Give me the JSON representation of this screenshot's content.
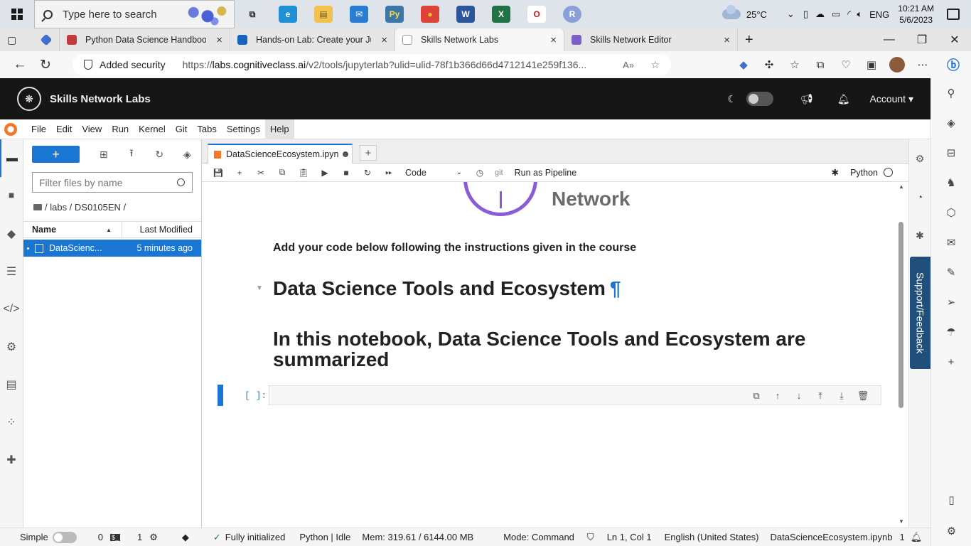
{
  "taskbar": {
    "search_placeholder": "Type here to search",
    "apps": [
      {
        "name": "task-view",
        "glyph": "⧉",
        "color": "transparent",
        "fg": "#222"
      },
      {
        "name": "edge",
        "glyph": "e",
        "color": "#1f8fd6",
        "fg": "#fff"
      },
      {
        "name": "file-explorer",
        "glyph": "▤",
        "color": "#f2c14e",
        "fg": "#6b5a1a"
      },
      {
        "name": "mail",
        "glyph": "✉",
        "color": "#2b7cd3",
        "fg": "#fff"
      },
      {
        "name": "python",
        "glyph": "Py",
        "color": "#3b77a8",
        "fg": "#ffd845"
      },
      {
        "name": "chrome",
        "glyph": "●",
        "color": "#db4437",
        "fg": "#fbc02d"
      },
      {
        "name": "word",
        "glyph": "W",
        "color": "#2b579a",
        "fg": "#fff"
      },
      {
        "name": "excel",
        "glyph": "X",
        "color": "#217346",
        "fg": "#fff"
      },
      {
        "name": "opera",
        "glyph": "O",
        "color": "#ffffff",
        "fg": "#e0161b"
      },
      {
        "name": "profile",
        "glyph": "R",
        "color": "#8aa0d8",
        "fg": "#fff"
      }
    ],
    "weather": "25°C",
    "language": "ENG",
    "time": "10:21 AM",
    "date": "5/6/2023"
  },
  "browser": {
    "tabs": [
      {
        "title": "Python Data Science Handbook.p",
        "favicon_color": "#c43b3b",
        "active": false
      },
      {
        "title": "Hands-on Lab: Create your Jupyt",
        "favicon_color": "#1565c0",
        "active": false
      },
      {
        "title": "Skills Network Labs",
        "favicon_color": "#ffffff",
        "active": true
      },
      {
        "title": "Skills Network Editor",
        "favicon_color": "#7b5ec8",
        "active": false
      }
    ],
    "security_label": "Added security",
    "url_prefix": "https://",
    "url_host": "labs.cognitiveclass.ai",
    "url_rest": "/v2/tools/jupyterlab?ulid=ulid-78f1b366d66d4712141e259f136..."
  },
  "skills_network": {
    "title": "Skills Network Labs",
    "account_label": "Account ▾"
  },
  "jupyter": {
    "menu": [
      "File",
      "Edit",
      "View",
      "Run",
      "Kernel",
      "Git",
      "Tabs",
      "Settings",
      "Help"
    ],
    "active_menu": "Help",
    "file_browser": {
      "new_label": "+",
      "filter_placeholder": "Filter files by name",
      "breadcrumb": "/ labs / DS0105EN /",
      "col_name": "Name",
      "col_modified": "Last Modified",
      "files": [
        {
          "name": "DataScienc...",
          "modified": "5 minutes ago"
        }
      ]
    },
    "notebook": {
      "tab_title": "DataScienceEcosystem.ipyn",
      "cell_type": "Code",
      "git_label": "git",
      "pipeline_label": "Run as Pipeline",
      "kernel_name": "Python",
      "logo_text": "Network",
      "instruction": "Add your code below following the instructions given in the course",
      "heading1": "Data Science Tools and Ecosystem",
      "pilcrow": "¶",
      "heading2": "In this notebook, Data Science Tools and Ecosystem are summarized",
      "prompt": "[ ]:"
    },
    "support_label": "Support/Feedback",
    "status": {
      "mode_label": "Simple",
      "terminals": "0",
      "kernels": "1",
      "init_status": "Fully initialized",
      "kernel_status": "Python | Idle",
      "memory": "Mem: 319.61 / 6144.00 MB",
      "command_mode": "Mode: Command",
      "cursor_pos": "Ln 1, Col 1",
      "language": "English (United States)",
      "filename": "DataScienceEcosystem.ipynb",
      "notif_count": "1"
    }
  }
}
